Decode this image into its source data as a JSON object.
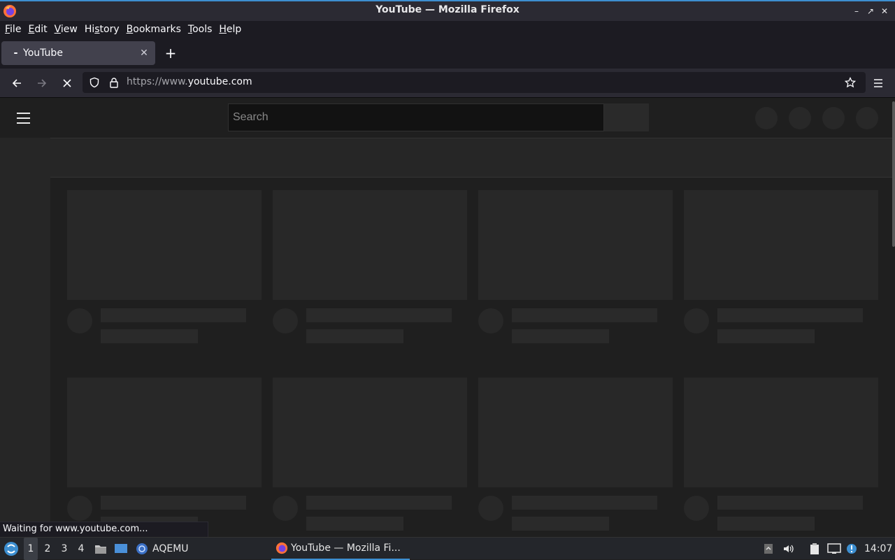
{
  "window": {
    "title": "YouTube — Mozilla Firefox"
  },
  "menubar": {
    "items": [
      {
        "u": "F",
        "rest": "ile"
      },
      {
        "u": "E",
        "rest": "dit"
      },
      {
        "u": "V",
        "rest": "iew"
      },
      {
        "pre": "Hi",
        "u": "s",
        "rest": "tory"
      },
      {
        "u": "B",
        "rest": "ookmarks"
      },
      {
        "u": "T",
        "rest": "ools"
      },
      {
        "u": "H",
        "rest": "elp"
      }
    ]
  },
  "tabs": [
    {
      "title": "YouTube",
      "loading": true
    }
  ],
  "navbar": {
    "url_prefix": "https://www.",
    "url_host": "youtube.com"
  },
  "page": {
    "search_placeholder": "Search"
  },
  "status_text": "Waiting for www.youtube.com...",
  "taskbar": {
    "workspaces": [
      "1",
      "2",
      "3",
      "4"
    ],
    "active_workspace": "1",
    "app_label": "AQEMU",
    "task_label": "YouTube — Mozilla Fi...",
    "clock": "14:07"
  },
  "colors": {
    "accent": "#3d8fd1",
    "chrome_bg": "#2b2a33",
    "page_bg": "#1f1f1f"
  }
}
